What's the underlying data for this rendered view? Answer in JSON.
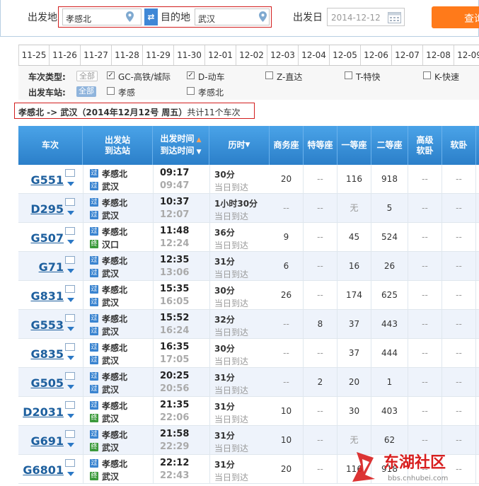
{
  "search": {
    "from_label": "出发地",
    "from_value": "孝感北",
    "swap_icon": "⇄",
    "to_label": "目的地",
    "to_value": "武汉",
    "date_label": "出发日",
    "date_value": "2014-12-12",
    "query_label": "查询"
  },
  "dates": [
    "11-25",
    "11-26",
    "11-27",
    "11-28",
    "11-29",
    "11-30",
    "12-01",
    "12-02",
    "12-03",
    "12-04",
    "12-05",
    "12-06",
    "12-07",
    "12-08",
    "12-09"
  ],
  "filters": {
    "type_label": "车次类型:",
    "type_all": "全部",
    "types": [
      {
        "label": "GC-高铁/城际",
        "checked": true
      },
      {
        "label": "D-动车",
        "checked": true
      },
      {
        "label": "Z-直达",
        "checked": false
      },
      {
        "label": "T-特快",
        "checked": false
      },
      {
        "label": "K-快速",
        "checked": false
      }
    ],
    "station_label": "出发车站:",
    "station_all": "全部",
    "stations": [
      {
        "label": "孝感",
        "checked": false
      },
      {
        "label": "孝感北",
        "checked": false
      }
    ]
  },
  "summary": {
    "route": "孝感北 -> 武汉（2014年12月12号  周五）",
    "count": "共计11个车次"
  },
  "table": {
    "headers": {
      "train": "车次",
      "station_from": "出发站",
      "station_to": "到达站",
      "time_depart": "出发时间",
      "time_arrive": "到达时间",
      "duration": "历时",
      "business": "商务座",
      "special": "特等座",
      "first": "一等座",
      "second": "二等座",
      "premium_soft": "高级",
      "premium_soft2": "软卧",
      "soft": "软卧"
    },
    "pass_tag": "过",
    "end_tag": "终",
    "rows": [
      {
        "train": "G551",
        "from": "孝感北",
        "to": "武汉",
        "to_tag": "过",
        "dep": "09:17",
        "arr": "09:47",
        "dur": "30分",
        "note": "当日到达",
        "business": "20",
        "special": "--",
        "first": "116",
        "second": "918",
        "premium": "--",
        "soft": "--"
      },
      {
        "train": "D295",
        "from": "孝感北",
        "to": "武汉",
        "to_tag": "过",
        "dep": "10:37",
        "arr": "12:07",
        "dur": "1小时30分",
        "note": "当日到达",
        "business": "--",
        "special": "--",
        "first": "无",
        "second": "5",
        "premium": "--",
        "soft": "--"
      },
      {
        "train": "G507",
        "from": "孝感北",
        "to": "汉口",
        "to_tag": "终",
        "dep": "11:48",
        "arr": "12:24",
        "dur": "36分",
        "note": "当日到达",
        "business": "9",
        "special": "--",
        "first": "45",
        "second": "524",
        "premium": "--",
        "soft": "--"
      },
      {
        "train": "G71",
        "from": "孝感北",
        "to": "武汉",
        "to_tag": "过",
        "dep": "12:35",
        "arr": "13:06",
        "dur": "31分",
        "note": "当日到达",
        "business": "6",
        "special": "--",
        "first": "16",
        "second": "26",
        "premium": "--",
        "soft": "--"
      },
      {
        "train": "G831",
        "from": "孝感北",
        "to": "武汉",
        "to_tag": "过",
        "dep": "15:35",
        "arr": "16:05",
        "dur": "30分",
        "note": "当日到达",
        "business": "26",
        "special": "--",
        "first": "174",
        "second": "625",
        "premium": "--",
        "soft": "--"
      },
      {
        "train": "G553",
        "from": "孝感北",
        "to": "武汉",
        "to_tag": "过",
        "dep": "15:52",
        "arr": "16:24",
        "dur": "32分",
        "note": "当日到达",
        "business": "--",
        "special": "8",
        "first": "37",
        "second": "443",
        "premium": "--",
        "soft": "--"
      },
      {
        "train": "G835",
        "from": "孝感北",
        "to": "武汉",
        "to_tag": "过",
        "dep": "16:35",
        "arr": "17:05",
        "dur": "30分",
        "note": "当日到达",
        "business": "--",
        "special": "--",
        "first": "37",
        "second": "444",
        "premium": "--",
        "soft": "--"
      },
      {
        "train": "G505",
        "from": "孝感北",
        "to": "武汉",
        "to_tag": "过",
        "dep": "20:25",
        "arr": "20:56",
        "dur": "31分",
        "note": "当日到达",
        "business": "--",
        "special": "2",
        "first": "20",
        "second": "1",
        "premium": "--",
        "soft": "--"
      },
      {
        "train": "D2031",
        "from": "孝感北",
        "to": "武汉",
        "to_tag": "终",
        "dep": "21:35",
        "arr": "22:06",
        "dur": "31分",
        "note": "当日到达",
        "business": "10",
        "special": "--",
        "first": "30",
        "second": "403",
        "premium": "--",
        "soft": "--"
      },
      {
        "train": "G691",
        "from": "孝感北",
        "to": "武汉",
        "to_tag": "终",
        "dep": "21:58",
        "arr": "22:29",
        "dur": "31分",
        "note": "当日到达",
        "business": "10",
        "special": "--",
        "first": "无",
        "second": "62",
        "premium": "--",
        "soft": "--"
      },
      {
        "train": "G6801",
        "from": "孝感北",
        "to": "武汉",
        "to_tag": "终",
        "dep": "22:12",
        "arr": "22:43",
        "dur": "31分",
        "note": "当日到达",
        "business": "20",
        "special": "--",
        "first": "116",
        "second": "918",
        "premium": "--",
        "soft": "--"
      }
    ]
  },
  "watermark": {
    "title": "东湖社区",
    "url": "bbs.cnhubei.com"
  },
  "colors": {
    "header_blue": "#2b7fc9",
    "train_link": "#1d5f9e",
    "depart_time": "#222222",
    "arrive_time": "#aaaaaa",
    "pass_tag": "#3a84d0",
    "end_tag": "#3c9a3c",
    "query_orange": "#ff7a1a",
    "highlight_red": "#d21d1d"
  }
}
